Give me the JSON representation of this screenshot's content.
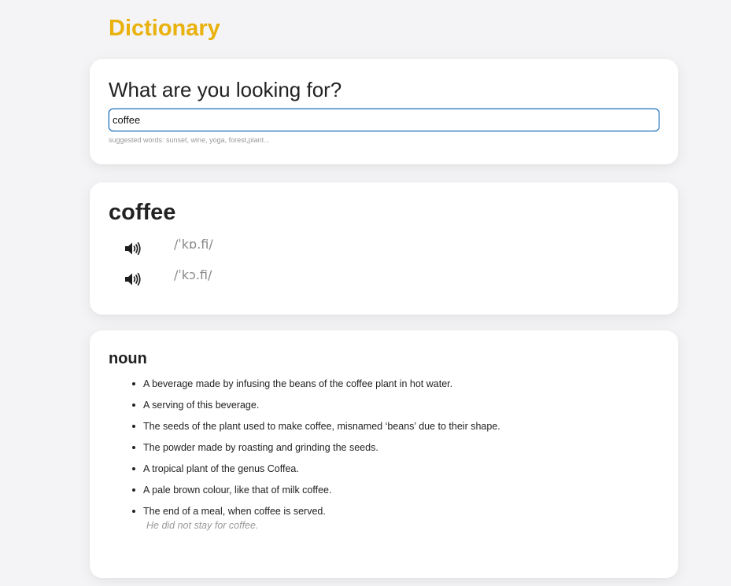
{
  "app": {
    "title": "Dictionary"
  },
  "search": {
    "heading": "What are you looking for?",
    "value": "coffee",
    "suggestions": "suggested words: sunset, wine, yoga, forest,plant..."
  },
  "word": {
    "headword": "coffee",
    "phonetics": [
      {
        "text": "/ˈkɒ.fi/",
        "icon": "speaker-icon"
      },
      {
        "text": "/ˈkɔ.fi/",
        "icon": "speaker-icon"
      }
    ]
  },
  "meaning": {
    "part_of_speech": "noun",
    "definitions": [
      {
        "text": "A beverage made by infusing the beans of the coffee plant in hot water."
      },
      {
        "text": "A serving of this beverage."
      },
      {
        "text": "The seeds of the plant used to make coffee, misnamed ‘beans’ due to their shape."
      },
      {
        "text": "The powder made by roasting and grinding the seeds."
      },
      {
        "text": "A tropical plant of the genus Coffea."
      },
      {
        "text": "A pale brown colour, like that of milk coffee."
      },
      {
        "text": "The end of a meal, when coffee is served.",
        "example": "He did not stay for coffee."
      }
    ]
  },
  "colors": {
    "accent": "#e9b10c",
    "input_border": "#1a6fb8",
    "muted_text": "#888888",
    "background": "#f4f4f6",
    "card": "#ffffff"
  }
}
